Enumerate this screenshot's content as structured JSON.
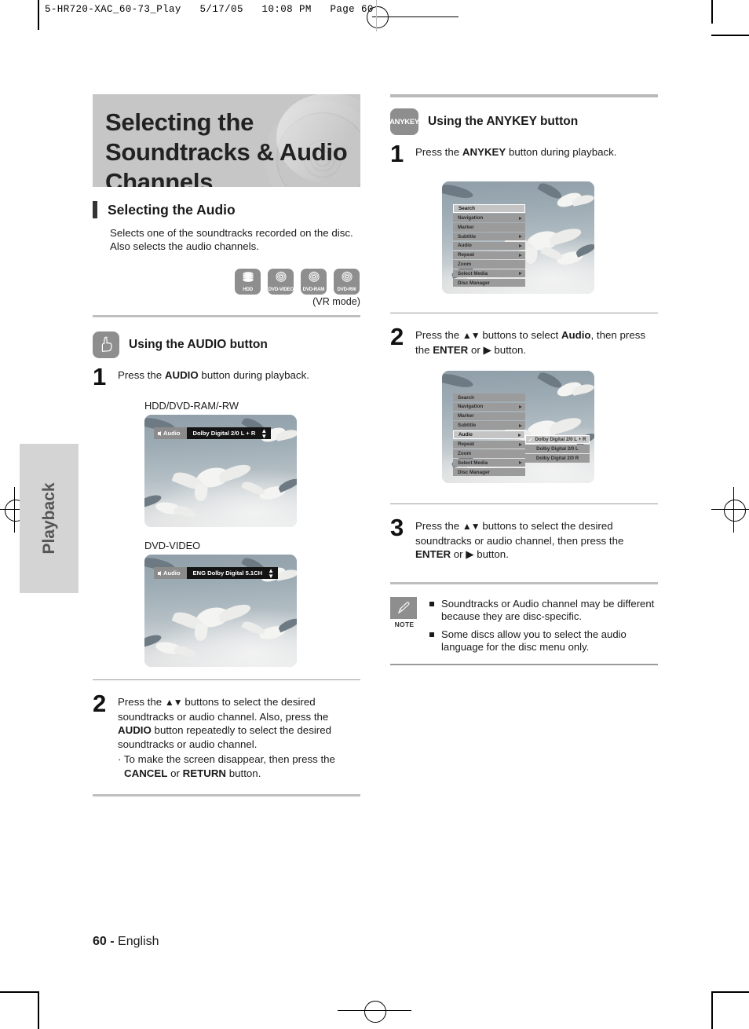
{
  "slug": "5-HR720-XAC_60-73_Play   5/17/05   10:08 PM   Page 60",
  "side_tab": {
    "label": "Playback"
  },
  "footer": {
    "page": "60 -",
    "language": "English"
  },
  "left": {
    "chapter_title": "Selecting the Soundtracks & Audio Channels",
    "section": {
      "heading": "Selecting the Audio",
      "body": "Selects one of the soundtracks recorded on the disc. Also selects the audio channels."
    },
    "disc_icons": [
      {
        "name": "HDD",
        "glyph": "hdd-stack-icon"
      },
      {
        "name": "DVD-VIDEO",
        "glyph": "disc-icon"
      },
      {
        "name": "DVD-RAM",
        "glyph": "disc-icon"
      },
      {
        "name": "DVD-RW",
        "glyph": "disc-icon"
      }
    ],
    "vr_mode": "(VR mode)",
    "method": {
      "badge_icon": "hand-press-button-icon",
      "heading": "Using the AUDIO button"
    },
    "step1": {
      "num": "1",
      "text_pre": "Press the ",
      "text_bold": "AUDIO",
      "text_post": " button during playback."
    },
    "shot1": {
      "label": "HDD/DVD-RAM/-RW",
      "osd_tag": "Audio",
      "osd_value": "Dolby Digital 2/0 L + R"
    },
    "shot2": {
      "label": "DVD-VIDEO",
      "osd_tag": "Audio",
      "osd_value": "ENG Dolby Digital 5.1CH"
    },
    "step2": {
      "num": "2",
      "line1_a": "Press the ",
      "line1_arrows": "▲▼",
      "line1_b": " buttons to select the desired soundtracks or audio channel. Also, press the ",
      "line1_bold": "AUDIO",
      "line1_c": " button repeatedly to select the desired soundtracks or audio channel.",
      "bullet_a": "· To make the screen disappear, then press the ",
      "bullet_bold1": "CANCEL",
      "bullet_b": " or ",
      "bullet_bold2": "RETURN",
      "bullet_c": " button."
    }
  },
  "right": {
    "method": {
      "badge_label": "ANYKEY",
      "heading": "Using the ANYKEY button"
    },
    "step1": {
      "num": "1",
      "text_pre": "Press the ",
      "text_bold": "ANYKEY",
      "text_post": " button during playback."
    },
    "menu": {
      "items": [
        {
          "label": "Search",
          "arrow": false,
          "selected": true
        },
        {
          "label": "Navigation",
          "arrow": true,
          "selected": false
        },
        {
          "label": "Marker",
          "arrow": false,
          "selected": false
        },
        {
          "label": "Subtitle",
          "arrow": true,
          "selected": false
        },
        {
          "label": "Audio",
          "arrow": true,
          "selected": false
        },
        {
          "label": "Repeat",
          "arrow": true,
          "selected": false
        },
        {
          "label": "Zoom",
          "arrow": false,
          "selected": false
        },
        {
          "label": "Select Media",
          "arrow": true,
          "selected": false
        },
        {
          "label": "Disc Manager",
          "arrow": false,
          "selected": false
        }
      ]
    },
    "step2": {
      "num": "2",
      "line_a": "Press the ",
      "arrows": "▲▼",
      "line_b": " buttons to select ",
      "bold1": "Audio",
      "line_c": ", then press the ",
      "bold2": "ENTER",
      "line_d": " or ",
      "right_arrow": "▶",
      "line_e": " button."
    },
    "menu2": {
      "items": [
        {
          "label": "Search",
          "arrow": false,
          "selected": false
        },
        {
          "label": "Navigation",
          "arrow": true,
          "selected": false
        },
        {
          "label": "Marker",
          "arrow": false,
          "selected": false
        },
        {
          "label": "Subtitle",
          "arrow": true,
          "selected": false
        },
        {
          "label": "Audio",
          "arrow": true,
          "selected": true
        },
        {
          "label": "Repeat",
          "arrow": true,
          "selected": false
        },
        {
          "label": "Zoom",
          "arrow": false,
          "selected": false
        },
        {
          "label": "Select Media",
          "arrow": true,
          "selected": false
        },
        {
          "label": "Disc Manager",
          "arrow": false,
          "selected": false
        }
      ],
      "submenu": [
        {
          "label": "Dolby Digital 2/0 L + R",
          "checked": true
        },
        {
          "label": "Dolby Digital 2/0 L",
          "checked": false
        },
        {
          "label": "Dolby Digital 2/0 R",
          "checked": false
        }
      ]
    },
    "step3": {
      "num": "3",
      "line_a": "Press the ",
      "arrows": "▲▼",
      "line_b": " buttons to select the desired soundtracks or audio channel, then press the ",
      "bold1": "ENTER",
      "line_c": " or ",
      "right_arrow": "▶",
      "line_d": " button."
    },
    "note": {
      "badge_icon": "pencil-icon",
      "label": "NOTE",
      "items": [
        "Soundtracks or Audio channel may be different because they are disc-specific.",
        "Some discs allow you to select the audio language for the disc menu only."
      ]
    }
  }
}
